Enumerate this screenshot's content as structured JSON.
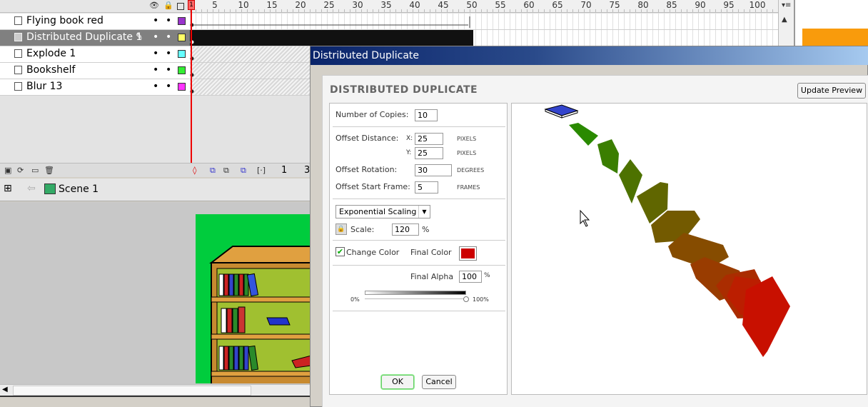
{
  "timeline": {
    "ruler_ticks": [
      "1",
      "5",
      "10",
      "15",
      "20",
      "25",
      "30",
      "35",
      "40",
      "45",
      "50",
      "55",
      "60",
      "65",
      "70",
      "75",
      "80",
      "85",
      "90",
      "95",
      "100"
    ],
    "header_icons": [
      "eye-icon",
      "lock-icon",
      "outline-icon"
    ],
    "layers": [
      {
        "name": "Flying book red",
        "color": "#9933cc",
        "selected": false
      },
      {
        "name": "Distributed Duplicate 1",
        "color": "#ffff66",
        "selected": true
      },
      {
        "name": "Explode 1",
        "color": "#66ffff",
        "selected": false
      },
      {
        "name": "Bookshelf",
        "color": "#33ee33",
        "selected": false
      },
      {
        "name": "Blur 13",
        "color": "#ff33ff",
        "selected": false
      }
    ],
    "current_frame": "1",
    "frame_rate_partial": "3"
  },
  "scene": {
    "label": "Scene 1"
  },
  "dialog": {
    "title": "Distributed Duplicate",
    "heading": "DISTRIBUTED DUPLICATE",
    "update_preview": "Update Preview",
    "number_of_copies_label": "Number of Copies:",
    "number_of_copies": "10",
    "offset_distance_label": "Offset Distance:",
    "x_label": "X:",
    "y_label": "Y:",
    "offset_x": "25",
    "offset_y": "25",
    "pixels_unit": "PIXELS",
    "offset_rotation_label": "Offset Rotation:",
    "offset_rotation": "30",
    "degrees_unit": "DEGREES",
    "offset_start_frame_label": "Offset Start Frame:",
    "offset_start_frame": "5",
    "frames_unit": "FRAMES",
    "scaling_option": "Exponential Scaling",
    "scale_label": "Scale:",
    "scale_value": "120",
    "percent": "%",
    "change_color_label": "Change Color",
    "change_color_checked": true,
    "final_color_label": "Final Color",
    "final_color": "#cc0000",
    "final_alpha_label": "Final Alpha",
    "final_alpha": "100",
    "alpha_min": "0%",
    "alpha_max": "100%",
    "alpha_level": 1.0,
    "ok": "OK",
    "cancel": "Cancel"
  },
  "colors": {
    "stage_green": "#00cc3d",
    "preview_start": "#2a8a00",
    "preview_end": "#c81000",
    "accent_orange": "#f99b0c"
  }
}
